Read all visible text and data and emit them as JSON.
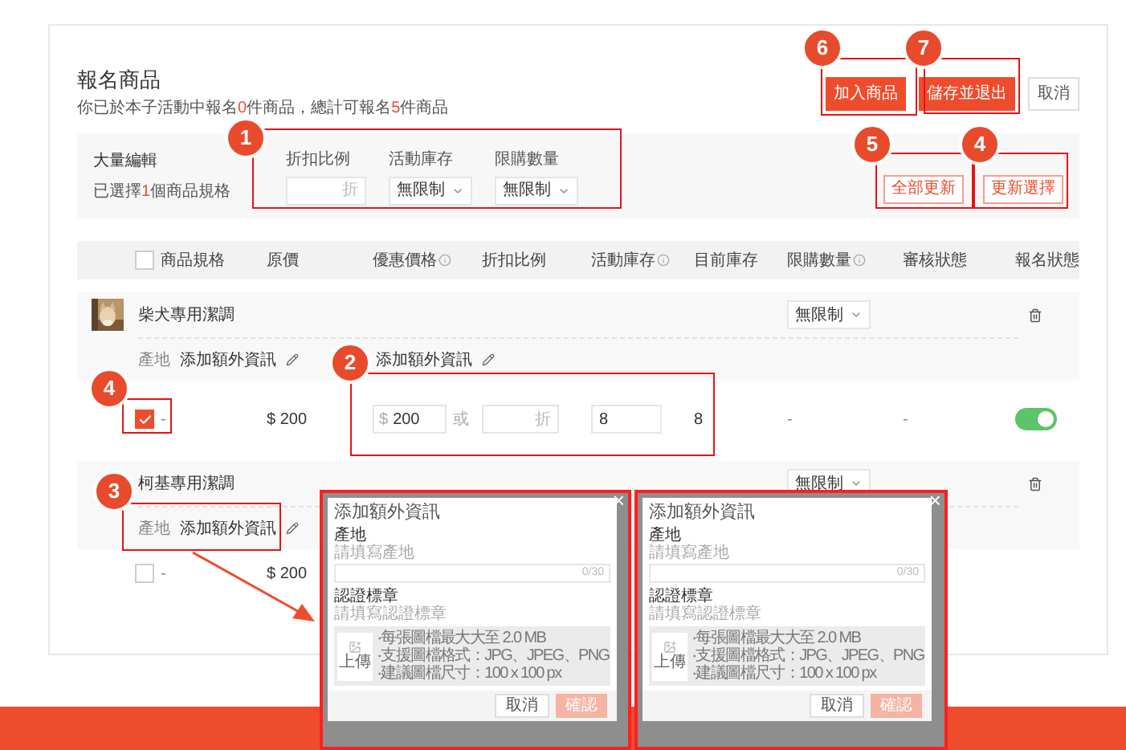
{
  "header": {
    "title": "報名商品",
    "summary": [
      {
        "text": "你已於本子活動中報名",
        "highlight": false
      },
      {
        "text": "0",
        "highlight": true
      },
      {
        "text": "件商品，總計可報名",
        "highlight": false
      },
      {
        "text": "5",
        "highlight": true
      },
      {
        "text": "件商品",
        "highlight": false
      }
    ]
  },
  "actions": [
    {
      "label": "加入商品",
      "kind": "primary"
    },
    {
      "label": "儲存並退出",
      "kind": "primary"
    },
    {
      "label": "取消",
      "kind": "default"
    }
  ],
  "bulk_edit": {
    "title": "大量編輯",
    "selection": [
      {
        "text": "已選擇",
        "highlight": false
      },
      {
        "text": "1",
        "highlight": true
      },
      {
        "text": "個商品規格",
        "highlight": false
      }
    ],
    "fields": [
      {
        "label": "折扣比例",
        "kind": "input",
        "suffix": "折"
      },
      {
        "label": "活動庫存",
        "kind": "select",
        "value": "無限制"
      },
      {
        "label": "限購數量",
        "kind": "select",
        "value": "無限制"
      }
    ],
    "buttons": [
      {
        "label": "全部更新"
      },
      {
        "label": "更新選擇"
      }
    ]
  },
  "table": {
    "select_all": {
      "checked": false
    },
    "columns": [
      {
        "label": "商品規格",
        "info": false
      },
      {
        "label": "原價",
        "info": false
      },
      {
        "label": "優惠價格",
        "info": true
      },
      {
        "label": "折扣比例",
        "info": false
      },
      {
        "label": "活動庫存",
        "info": true
      },
      {
        "label": "目前庫存",
        "info": false
      },
      {
        "label": "限購數量",
        "info": true
      },
      {
        "label": "審核狀態",
        "info": false
      },
      {
        "label": "報名狀態",
        "info": false
      }
    ],
    "products": [
      {
        "name": "柴犬專用潔調",
        "image": true,
        "limit": "無限制",
        "extras": [
          {
            "label": "產地",
            "action": "添加額外資訊"
          },
          {
            "action": "添加額外資訊"
          }
        ],
        "variations": [
          {
            "checked": true,
            "spec": "-",
            "price": "$ 200",
            "currency": "$",
            "promo_price": "200",
            "or": "或",
            "discount_suffix": "折",
            "stock": "8",
            "current_stock": "8",
            "limit": "-",
            "review": "-",
            "enrolled": true
          }
        ]
      },
      {
        "name": "柯基專用潔調",
        "limit": "無限制",
        "extras": [
          {
            "label": "產地",
            "action": "添加額外資訊"
          }
        ],
        "variations": [
          {
            "checked": false,
            "spec": "-",
            "price": "$ 200"
          }
        ]
      }
    ]
  },
  "callouts": [
    {
      "number": "6"
    },
    {
      "number": "7"
    },
    {
      "number": "1"
    },
    {
      "number": "5"
    },
    {
      "number": "4"
    },
    {
      "number": "2"
    },
    {
      "number": "4"
    },
    {
      "number": "3"
    }
  ],
  "dialogs": [
    {
      "title": "添加額外資訊",
      "close": "×",
      "fields": [
        {
          "label": "產地",
          "hint": "請填寫產地",
          "counter": "0/30"
        }
      ],
      "badge_field": {
        "label": "認證標章",
        "hint": "請填寫認證標章"
      },
      "upload": {
        "label": "上傳",
        "notes": [
          "‧每張圖檔最大大至 2.0 MB",
          "‧支援圖檔格式：JPG、JPEG、PNG",
          "‧建議圖檔尺寸：100 x 100 px"
        ]
      },
      "buttons": [
        {
          "label": "取消",
          "disabled": false
        },
        {
          "label": "確認",
          "disabled": true
        }
      ]
    },
    {
      "title": "添加額外資訊",
      "close": "×",
      "fields": [
        {
          "label": "產地",
          "hint": "請填寫產地",
          "counter": "0/30"
        }
      ],
      "badge_field": {
        "label": "認證標章",
        "hint": "請填寫認證標章"
      },
      "upload": {
        "label": "上傳",
        "notes": [
          "‧每張圖檔最大大至 2.0 MB",
          "‧支援圖檔格式：JPG、JPEG、PNG",
          "‧建議圖檔尺寸：100 x 100 px"
        ]
      },
      "buttons": [
        {
          "label": "取消",
          "disabled": false
        },
        {
          "label": "確認",
          "disabled": true
        }
      ]
    }
  ]
}
